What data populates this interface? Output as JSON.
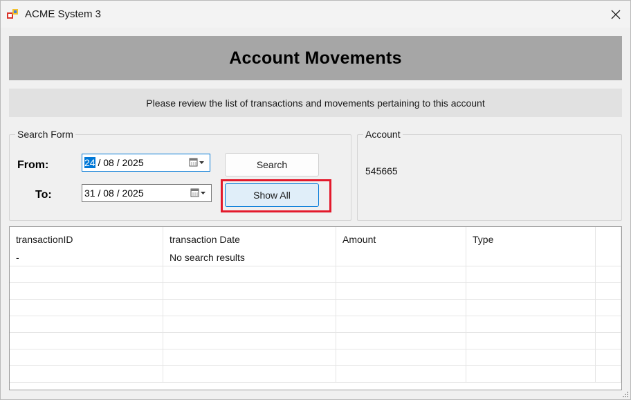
{
  "window": {
    "title": "ACME System 3"
  },
  "header": {
    "title": "Account Movements",
    "subtitle": "Please review the list of transactions and movements pertaining to this account"
  },
  "search_form": {
    "legend": "Search Form",
    "from_label": "From:",
    "to_label": "To:",
    "from_date": {
      "day": "24",
      "rest": " / 08 / 2025"
    },
    "to_date": "31 / 08 / 2025",
    "search_label": "Search",
    "show_all_label": "Show All"
  },
  "account": {
    "legend": "Account",
    "value": "545665"
  },
  "grid": {
    "columns": [
      "transactionID",
      "transaction Date",
      "Amount",
      "Type"
    ],
    "rows": [
      [
        "-",
        "No search results",
        "",
        ""
      ]
    ]
  },
  "colors": {
    "accent": "#0078d7",
    "highlight": "#e3192b",
    "banner": "#a6a6a6"
  },
  "icons": {
    "app": "app-icon",
    "close": "close-icon",
    "calendar": "calendar-dropdown-icon",
    "grip": "resize-grip-icon"
  }
}
